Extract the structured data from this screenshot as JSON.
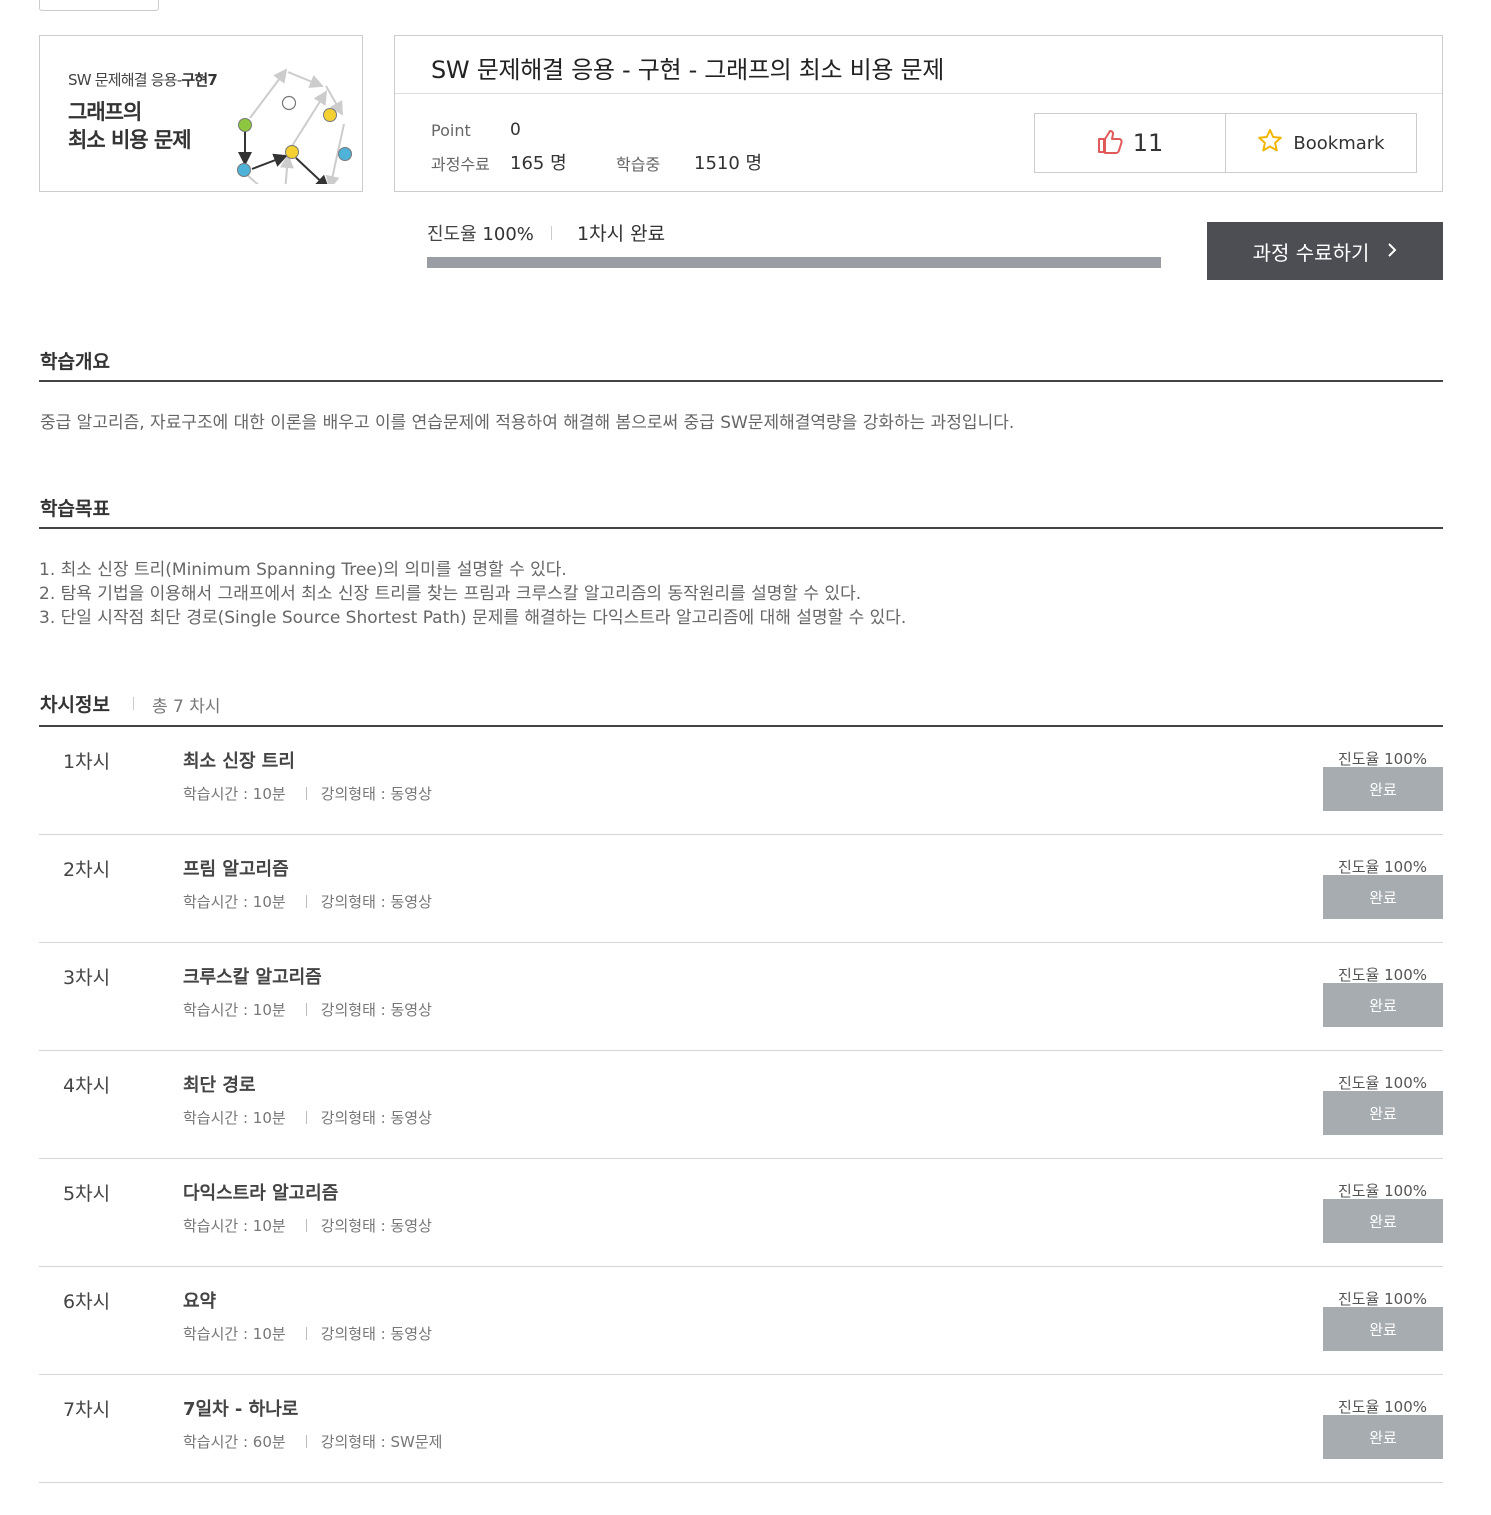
{
  "thumbnail": {
    "line1_prefix": "SW 문제해결 응용-",
    "line1_bold": "구현7",
    "line2": "그래프의",
    "line3": "최소 비용 문제"
  },
  "course": {
    "title": "SW 문제해결 응용 - 구현 - 그래프의 최소 비용 문제",
    "point_label": "Point",
    "point_value": "0",
    "completed_label": "과정수료",
    "completed_value": "165 명",
    "learning_label": "학습중",
    "learning_value": "1510 명",
    "likes": "11",
    "bookmark_label": "Bookmark"
  },
  "progress": {
    "label": "진도율",
    "percent_text": "100%",
    "percent": 100,
    "session_status": "1차시 완료",
    "complete_button": "과정 수료하기"
  },
  "overview": {
    "title": "학습개요",
    "text": "중급 알고리즘, 자료구조에 대한 이론을 배우고 이를 연습문제에 적용하여 해결해 봄으로써 중급 SW문제해결역량을 강화하는 과정입니다."
  },
  "goals": {
    "title": "학습목표",
    "items": [
      "1. 최소 신장 트리(Minimum Spanning Tree)의 의미를 설명할 수 있다.",
      "2. 탐욕 기법을 이용해서 그래프에서 최소 신장 트리를 찾는 프림과 크루스칼 알고리즘의 동작원리를 설명할 수 있다.",
      "3. 단일 시작점 최단 경로(Single Source Shortest Path) 문제를 해결하는 다익스트라 알고리즘에 대해 설명할 수 있다."
    ]
  },
  "sessions": {
    "title": "차시정보",
    "total": "총 7 차시",
    "items": [
      {
        "num": "1차시",
        "name": "최소 신장 트리",
        "time": "학습시간 : 10분",
        "type": "강의형태 : 동영상",
        "rate": "진도율 100%",
        "status": "완료"
      },
      {
        "num": "2차시",
        "name": "프림 알고리즘",
        "time": "학습시간 : 10분",
        "type": "강의형태 : 동영상",
        "rate": "진도율 100%",
        "status": "완료"
      },
      {
        "num": "3차시",
        "name": "크루스칼 알고리즘",
        "time": "학습시간 : 10분",
        "type": "강의형태 : 동영상",
        "rate": "진도율 100%",
        "status": "완료"
      },
      {
        "num": "4차시",
        "name": "최단 경로",
        "time": "학습시간 : 10분",
        "type": "강의형태 : 동영상",
        "rate": "진도율 100%",
        "status": "완료"
      },
      {
        "num": "5차시",
        "name": "다익스트라 알고리즘",
        "time": "학습시간 : 10분",
        "type": "강의형태 : 동영상",
        "rate": "진도율 100%",
        "status": "완료"
      },
      {
        "num": "6차시",
        "name": "요약",
        "time": "학습시간 : 10분",
        "type": "강의형태 : 동영상",
        "rate": "진도율 100%",
        "status": "완료"
      },
      {
        "num": "7차시",
        "name": "7일차 - 하나로",
        "time": "학습시간 : 60분",
        "type": "강의형태 : SW문제",
        "rate": "진도율 100%",
        "status": "완료"
      }
    ]
  },
  "icons": {
    "like": "thumbs-up-icon",
    "bookmark": "star-icon",
    "complete_arrow": "chevron-right-icon"
  },
  "colors": {
    "like_icon": "#e05a5a",
    "star_icon": "#f2b600",
    "complete_button_bg": "#4d4e54",
    "done_button_bg": "#a7acb0",
    "progress_fill": "#9a9da3"
  }
}
